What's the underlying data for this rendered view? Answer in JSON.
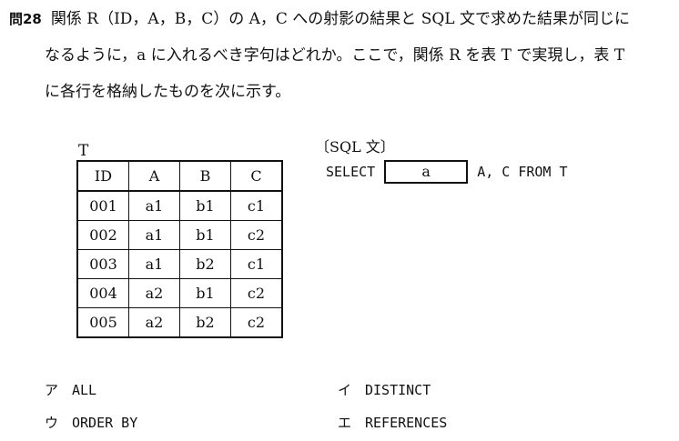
{
  "question": {
    "number": "問28",
    "line1": "関係 R（ID，A，B，C）の A，C への射影の結果と SQL 文で求めた結果が同じに",
    "line2": "なるように，a に入れるべき字句はどれか。ここで，関係 R を表 T で実現し，表 T",
    "line3": "に各行を格納したものを次に示す。"
  },
  "table": {
    "caption": "T",
    "headers": [
      "ID",
      "A",
      "B",
      "C"
    ],
    "rows": [
      [
        "001",
        "a1",
        "b1",
        "c1"
      ],
      [
        "002",
        "a1",
        "b1",
        "c2"
      ],
      [
        "003",
        "a1",
        "b2",
        "c1"
      ],
      [
        "004",
        "a2",
        "b1",
        "c2"
      ],
      [
        "005",
        "a2",
        "b2",
        "c2"
      ]
    ]
  },
  "sql": {
    "heading": "〔SQL 文〕",
    "select": "SELECT",
    "blank": "a",
    "rest": "A, C FROM T"
  },
  "choices": [
    {
      "mark": "ア",
      "text": "ALL"
    },
    {
      "mark": "イ",
      "text": "DISTINCT"
    },
    {
      "mark": "ウ",
      "text": "ORDER BY"
    },
    {
      "mark": "エ",
      "text": "REFERENCES"
    }
  ]
}
